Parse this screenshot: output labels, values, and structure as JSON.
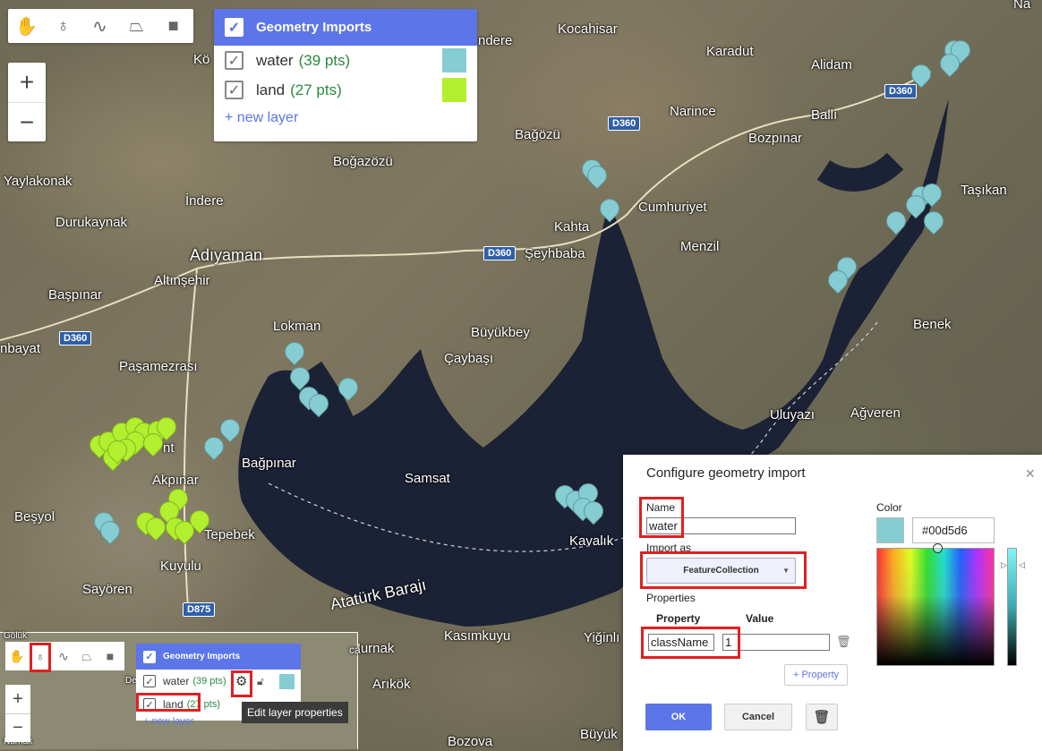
{
  "map": {
    "places": [
      "Kocahisar",
      "Karadut",
      "Alidam",
      "Narince",
      "Ballı",
      "Bağözü",
      "Bozpınar",
      "Boğazözü",
      "Yaylakonak",
      "İndere",
      "Durukaynak",
      "Cumhuriyet",
      "Kahta",
      "Şeyhbaba",
      "Taşıkan",
      "Menzil",
      "Adıyaman",
      "Altınşehir",
      "Başpınar",
      "Lokman",
      "Büyükbey",
      "Çaybaşı",
      "Paşamezrası",
      "Benek",
      "Uluyazı",
      "Ağveren",
      "Bağpınar",
      "Samsat",
      "Beşyol",
      "Akpınar",
      "Kuyulu",
      "Sayören",
      "Kavalık",
      "Atatürk Barajı",
      "Kasımkuyu",
      "Yiğinlı",
      "Arıkök",
      "Bozova",
      "nbayat",
      "Kö",
      "ndere",
      "Na",
      "Gölük",
      "Nurnak",
      "Dereh",
      "ca",
      "Büyük",
      "Tepebek",
      "nt"
    ],
    "roads": [
      "D360",
      "D360",
      "D360",
      "D360",
      "D875"
    ]
  },
  "toolbar": {
    "tools": [
      "hand-tool-icon",
      "point-marker-icon",
      "line-tool-icon",
      "polygon-tool-icon",
      "rectangle-tool-icon"
    ],
    "zoom_in": "+",
    "zoom_out": "−"
  },
  "geometry_imports": {
    "title": "Geometry Imports",
    "layers": [
      {
        "name": "water",
        "count": "(39 pts)",
        "color": "#85cdd2"
      },
      {
        "name": "land",
        "count": "(27 pts)",
        "color": "#b2ef2e"
      }
    ],
    "new_layer": "+ new layer"
  },
  "inset": {
    "title": "Geometry Imports",
    "water": "water",
    "water_count": "(39 pts)",
    "land": "land",
    "land_count": "(27 pts)",
    "new_layer": "+ new layer",
    "tooltip": "Edit layer properties",
    "zoom_in": "+",
    "zoom_out": "−"
  },
  "dialog": {
    "title": "Configure geometry import",
    "close": "×",
    "name_label": "Name",
    "name_value": "water",
    "import_as_label": "Import as",
    "import_as_value": "FeatureCollection",
    "properties_label": "Properties",
    "property_header": "Property",
    "value_header": "Value",
    "property_name": "className",
    "property_value": "1",
    "add_property": "+ Property",
    "color_label": "Color",
    "color_hex": "#00d5d6",
    "ok": "OK",
    "cancel": "Cancel"
  }
}
